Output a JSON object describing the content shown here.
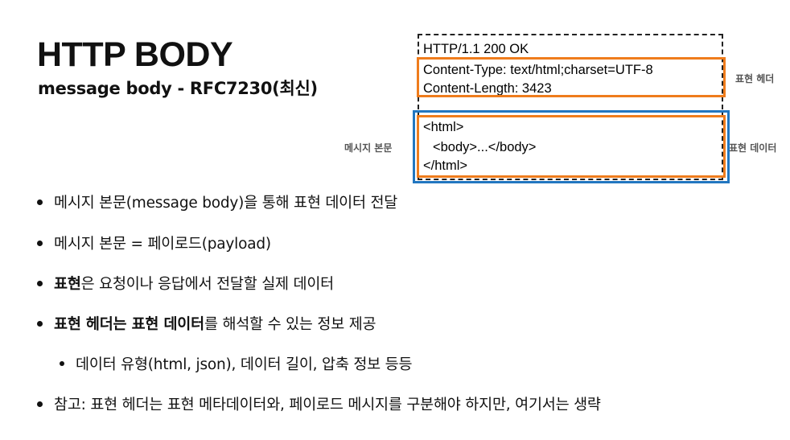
{
  "slide": {
    "title": "HTTP BODY",
    "subtitle": "message body - RFC7230(최신)"
  },
  "message": {
    "status_line": "HTTP/1.1 200 OK",
    "headers": [
      "Content-Type: text/html;charset=UTF-8",
      "Content-Length: 3423"
    ],
    "body_lines": [
      "<html>",
      "<body>...</body>",
      "</html>"
    ],
    "labels": {
      "representation_header": "표현 헤더",
      "representation_data": "표현 데이터",
      "message_body": "메시지 본문"
    },
    "colors": {
      "header_box": "#ef7c1c",
      "data_box": "#ef7c1c",
      "body_box": "#2276c0"
    }
  },
  "bullets": {
    "b1": "메시지 본문(message body)을 통해 표현 데이터 전달",
    "b2": "메시지 본문 = 페이로드(payload)",
    "b3": {
      "bold": "표현",
      "rest": "은 요청이나 응답에서 전달할 실제 데이터"
    },
    "b4": {
      "bold": "표현 헤더는 표현 데이터",
      "rest": "를 해석할 수 있는 정보 제공"
    },
    "b5": "데이터 유형(html, json), 데이터 길이, 압축 정보 등등",
    "b6": "참고: 표현 헤더는 표현 메타데이터와, 페이로드 메시지를 구분해야 하지만, 여기서는 생략"
  }
}
